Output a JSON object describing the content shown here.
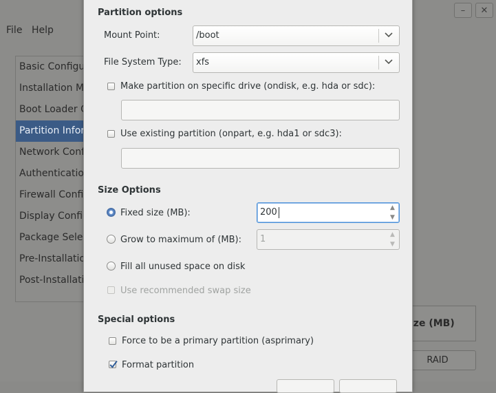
{
  "background_window": {
    "menu": [
      "File",
      "Help"
    ],
    "titlebar_buttons": [
      "–",
      "✕"
    ],
    "sidebar_items": [
      "Basic Configur",
      "Installation M",
      "Boot Loader O",
      "Partition Infor",
      "Network Confi",
      "Authenticatio",
      "Firewall Confi",
      "Display Config",
      "Package Selec",
      "Pre-Installatio",
      "Post-Installati"
    ],
    "selected_index": 3,
    "right_panel_label": "ize (MB)",
    "raid_button": "RAID"
  },
  "dialog": {
    "partition_options_title": "Partition options",
    "mount_point_label": "Mount Point:",
    "mount_point_value": "/boot",
    "fs_type_label": "File System Type:",
    "fs_type_value": "xfs",
    "ondisk_label": "Make partition on specific drive (ondisk, e.g. hda or sdc):",
    "ondisk_checked": false,
    "ondisk_value": "",
    "onpart_label": "Use existing partition (onpart, e.g. hda1 or sdc3):",
    "onpart_checked": false,
    "onpart_value": "",
    "size_options_title": "Size Options",
    "fixed_size_label": "Fixed size (MB):",
    "fixed_size_value": "200",
    "grow_label": "Grow to maximum of (MB):",
    "grow_value": "1",
    "fill_label": "Fill all unused space on disk",
    "swap_label": "Use recommended swap size",
    "special_options_title": "Special options",
    "primary_label": "Force to be a primary partition (asprimary)",
    "primary_checked": false,
    "format_label": "Format partition",
    "format_checked": true,
    "size_mode": "fixed"
  },
  "colors": {
    "selection": "#3b5b86",
    "focus": "#4a90d9",
    "radio_on": "#3f6aa8"
  }
}
